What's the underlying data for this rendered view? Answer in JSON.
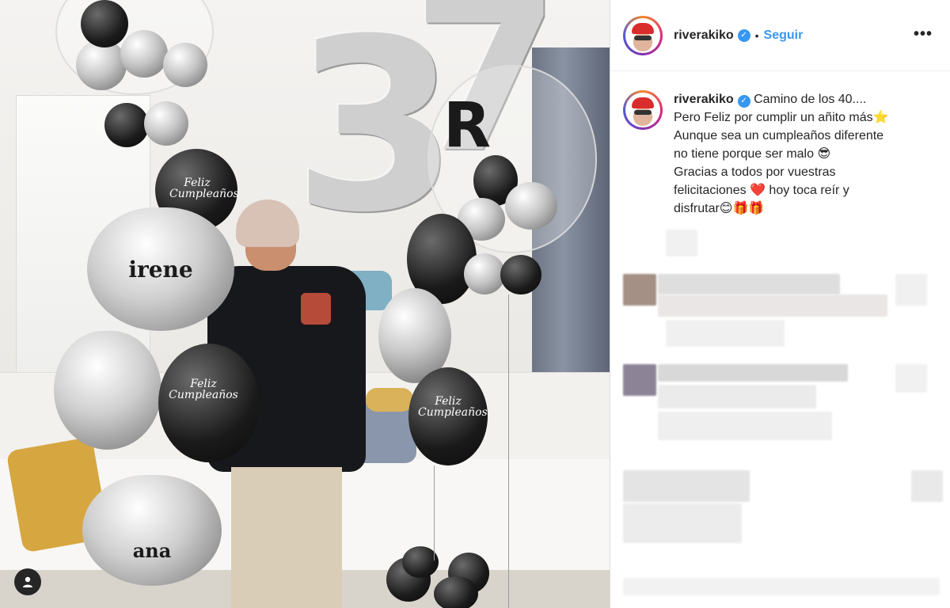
{
  "post": {
    "username": "riverakiko",
    "follow_label": "Seguir",
    "separator": "•",
    "more_label": "•••",
    "verified_mark": "✓",
    "caption_lines": [
      "Camino de los 40....",
      "Pero Feliz por cumplir un añito más⭐",
      "Aunque sea un cumpleaños diferente",
      "no tiene porque ser malo 😎",
      "Gracias a todos por vuestras",
      "felicitaciones ❤️ hoy toca reír y",
      "disfrutar😊🎁🎁"
    ]
  },
  "photo": {
    "balloon_names": [
      "irene",
      "ana"
    ],
    "digits": [
      "3",
      "7"
    ],
    "monogram": "R",
    "balloon_print": "Feliz Cumpleaños"
  },
  "colors": {
    "link": "#3897f0",
    "verified": "#3897f0",
    "text": "#262626"
  },
  "icons": [
    "verified-badge-icon",
    "more-options-icon",
    "user-tag-icon"
  ]
}
